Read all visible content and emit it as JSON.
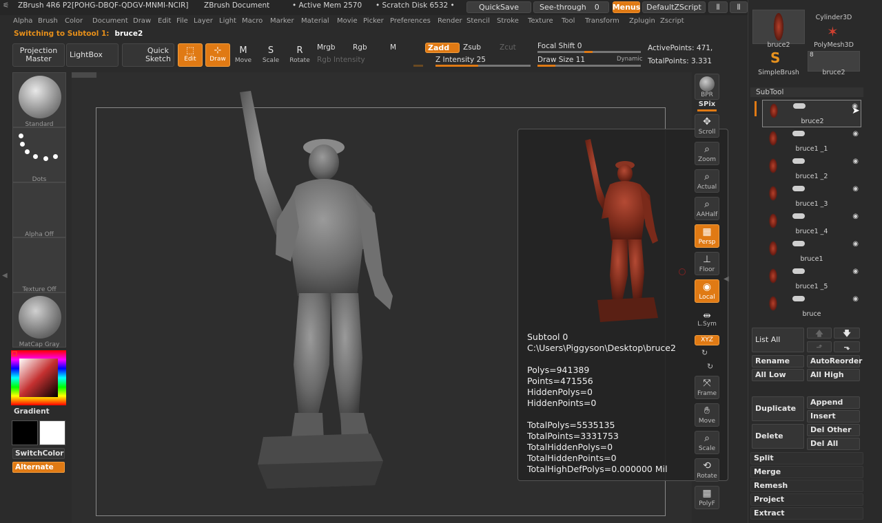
{
  "titlebar": {
    "app_title": "ZBrush 4R6 P2[POHG-DBQF-QDGV-MNMI-NCIR]",
    "doc_title": "ZBrush Document",
    "active_mem": "• Active Mem 2570",
    "scratch_disk": "• Scratch Disk 6532 •",
    "quicksave": "QuickSave",
    "seethrough": "See-through",
    "seethrough_value": "0",
    "menus": "Menus",
    "default_script": "DefaultZScript"
  },
  "menu": [
    "Alpha",
    "Brush",
    "Color",
    "Document",
    "Draw",
    "Edit",
    "File",
    "Layer",
    "Light",
    "Macro",
    "Marker",
    "Material",
    "Movie",
    "Picker",
    "Preferences",
    "Render",
    "Stencil",
    "Stroke",
    "Texture",
    "Tool",
    "Transform",
    "Zplugin",
    "Zscript"
  ],
  "status": {
    "prefix": "Switching to Subtool 1:",
    "name": "bruce2"
  },
  "toolbar": {
    "projection_master": "Projection\nMaster",
    "lightbox": "LightBox",
    "quick_sketch": "Quick\nSketch",
    "edit": "Edit",
    "draw": "Draw",
    "move": "Move",
    "scale": "Scale",
    "rotate": "Rotate",
    "mrgb": "Mrgb",
    "rgb": "Rgb",
    "m": "M",
    "rgb_intensity": "Rgb Intensity",
    "zadd": "Zadd",
    "zsub": "Zsub",
    "zcut": "Zcut",
    "z_intensity": "Z Intensity 25",
    "focal_shift": "Focal Shift 0",
    "draw_size": "Draw Size 11",
    "dynamic": "Dynamic",
    "active_points": "ActivePoints: 471,",
    "total_points": "TotalPoints: 3.331"
  },
  "left": {
    "brush": "Standard",
    "stroke": "Dots",
    "alpha": "Alpha Off",
    "texture": "Texture Off",
    "material": "MatCap Gray",
    "gradient": "Gradient",
    "switchcolor": "SwitchColor",
    "alternate": "Alternate"
  },
  "info": {
    "text": "Subtool 0\nC:\\Users\\Piggyson\\Desktop\\bruce2\n\nPolys=941389\nPoints=471556\nHiddenPolys=0\nHiddenPoints=0\n\nTotalPolys=5535135\nTotalPoints=3331753\nTotalHiddenPolys=0\nTotalHiddenPoints=0\nTotalHighDefPolys=0.000000 Mil"
  },
  "right_strip": [
    "BPR",
    "SPix",
    "Scroll",
    "Zoom",
    "Actual",
    "AAHalf",
    "Persp",
    "Floor",
    "Local",
    "L.Sym",
    "XYZ",
    "Frame",
    "Move",
    "Scale",
    "Rotate",
    "PolyF"
  ],
  "tools": {
    "t1": "bruce2",
    "t2": "Cylinder3D",
    "t3": "PolyMesh3D",
    "t4": "SimpleBrush",
    "t5": "bruce2",
    "t5_badge": "8"
  },
  "subtool": {
    "title": "SubTool",
    "items": [
      "bruce2",
      "bruce1 _1",
      "bruce1 _2",
      "bruce1 _3",
      "bruce1 _4",
      "bruce1",
      "bruce1 _5",
      "bruce"
    ],
    "list_all": "List All",
    "rename": "Rename",
    "autoreorder": "AutoReorder",
    "all_low": "All Low",
    "all_high": "All High",
    "duplicate": "Duplicate",
    "append": "Append",
    "insert": "Insert",
    "delete": "Delete",
    "del_other": "Del Other",
    "del_all": "Del All",
    "split": "Split",
    "merge": "Merge",
    "remesh": "Remesh",
    "project": "Project",
    "extract": "Extract"
  },
  "colors": {
    "accent": "#e07a14",
    "panel": "#2b2b2b",
    "primary_color": "#000000",
    "secondary_color": "#ffffff"
  }
}
